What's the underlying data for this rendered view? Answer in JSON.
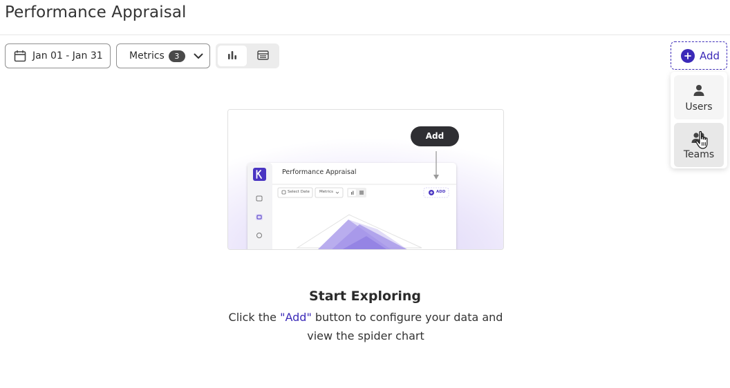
{
  "page": {
    "title": "Performance Appraisal"
  },
  "toolbar": {
    "date_range": "Jan 01 - Jan 31",
    "metrics_label": "Metrics",
    "metrics_count": "3",
    "view_modes": [
      "chart",
      "table"
    ],
    "active_view": "chart",
    "add_label": "Add"
  },
  "add_menu": {
    "items": [
      {
        "label": "Users",
        "icon": "user-icon"
      },
      {
        "label": "Teams",
        "icon": "teams-icon"
      }
    ]
  },
  "preview": {
    "callout_label": "Add",
    "title": "Performance Appraisal",
    "date_label": "Select Date",
    "metrics_label": "Metrics",
    "add_label": "ADD"
  },
  "empty_state": {
    "title": "Start Exploring",
    "desc_before": "Click the ",
    "desc_highlight": "\"Add\"",
    "desc_after": " button to configure your data and view the spider chart"
  },
  "colors": {
    "accent": "#3b2ab8",
    "border": "#8f8f8f",
    "badge": "#4a4a4a"
  }
}
